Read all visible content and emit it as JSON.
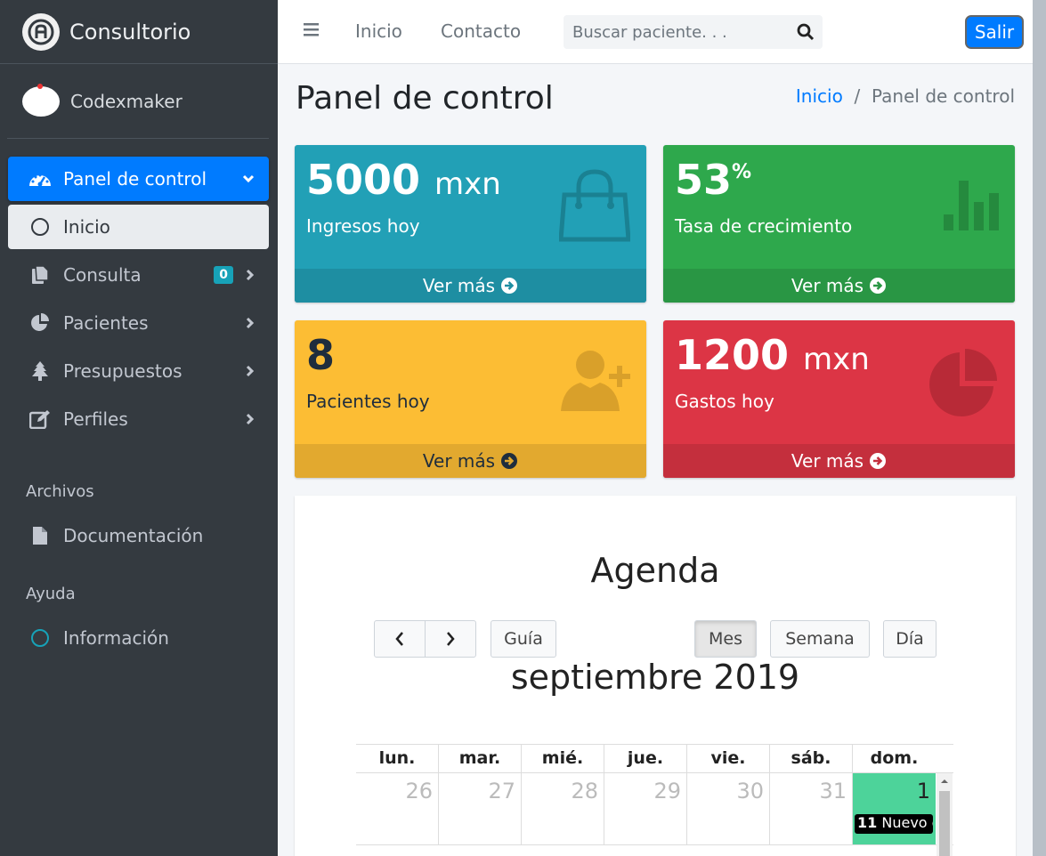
{
  "brand": {
    "title": "Consultorio"
  },
  "user": {
    "name": "Codexmaker"
  },
  "sidebar": {
    "items": [
      {
        "label": "Panel de control",
        "icon": "tachometer-icon"
      },
      {
        "label": "Inicio",
        "icon": "circle-icon"
      },
      {
        "label": "Consulta",
        "icon": "copy-icon",
        "badge": "0"
      },
      {
        "label": "Pacientes",
        "icon": "pie-chart-icon"
      },
      {
        "label": "Presupuestos",
        "icon": "tree-icon"
      },
      {
        "label": "Perfiles",
        "icon": "edit-icon"
      }
    ],
    "section_archivos": "Archivos",
    "documentacion": "Documentación",
    "section_ayuda": "Ayuda",
    "informacion": "Información"
  },
  "topbar": {
    "inicio": "Inicio",
    "contacto": "Contacto",
    "search_placeholder": "Buscar paciente. . .",
    "logout": "Salir"
  },
  "page": {
    "title": "Panel de control",
    "breadcrumb_home": "Inicio",
    "breadcrumb_sep": "/",
    "breadcrumb_current": "Panel de control"
  },
  "stats": [
    {
      "value": "5000",
      "unit": "mxn",
      "label": "Ingresos hoy",
      "more": "Ver más",
      "color": "#22a0b6"
    },
    {
      "value": "53",
      "unit": "%",
      "label": "Tasa de crecimiento",
      "more": "Ver más",
      "color": "#2ea84c"
    },
    {
      "value": "8",
      "unit": "",
      "label": "Pacientes hoy",
      "more": "Ver más",
      "color": "#fcbd34"
    },
    {
      "value": "1200",
      "unit": "mxn",
      "label": "Gastos hoy",
      "more": "Ver más",
      "color": "#dc3545"
    }
  ],
  "calendar": {
    "title": "Agenda",
    "guide_label": "Guía",
    "month_label": "Mes",
    "week_label": "Semana",
    "day_label": "Día",
    "current_month": "septiembre 2019",
    "weekdays": [
      "lun.",
      "mar.",
      "mié.",
      "jue.",
      "vie.",
      "sáb.",
      "dom."
    ],
    "first_week": [
      "26",
      "27",
      "28",
      "29",
      "30",
      "31",
      "1"
    ],
    "event_time": "11",
    "event_title": "Nuevo c"
  }
}
